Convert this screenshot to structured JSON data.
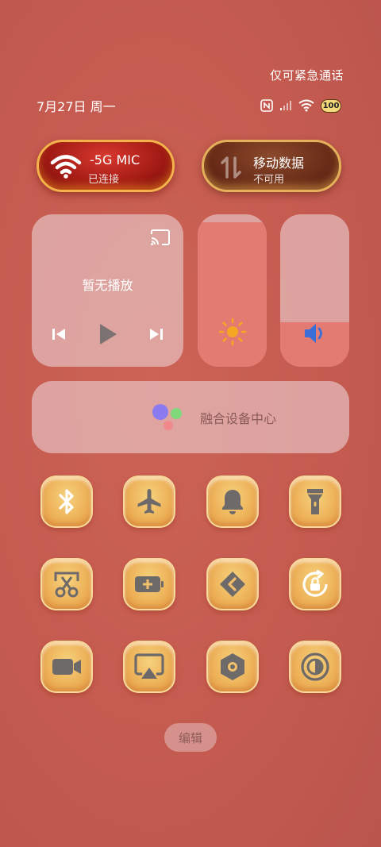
{
  "header": {
    "emergency_text": "仅可紧急通话",
    "date": "7月27日 周一",
    "battery_level": "100"
  },
  "toggles": {
    "wifi": {
      "title": "-5G    MIC",
      "subtitle": "已连接",
      "icon": "wifi-icon",
      "active": true
    },
    "mobile_data": {
      "title": "移动数据",
      "subtitle": "不可用",
      "icon": "data-transfer-icon",
      "active": false
    }
  },
  "media": {
    "status": "暂无播放",
    "icons": [
      "cast-icon",
      "previous-icon",
      "play-icon",
      "next-icon"
    ]
  },
  "brightness": {
    "level": 0.95,
    "icon": "sun-icon"
  },
  "volume": {
    "level": 0.29,
    "icon": "speaker-icon"
  },
  "fusion_center": {
    "label": "融合设备中心",
    "icon": "fusion-dots-icon"
  },
  "tiles": [
    {
      "name": "bluetooth",
      "icon": "bluetooth-icon"
    },
    {
      "name": "airplane-mode",
      "icon": "airplane-icon"
    },
    {
      "name": "ringer",
      "icon": "bell-icon"
    },
    {
      "name": "flashlight",
      "icon": "flashlight-icon"
    },
    {
      "name": "screenshot",
      "icon": "scissors-icon"
    },
    {
      "name": "power-saving",
      "icon": "battery-plus-icon"
    },
    {
      "name": "share",
      "icon": "share-chevron-icon"
    },
    {
      "name": "rotation-lock",
      "icon": "rotation-lock-icon"
    },
    {
      "name": "screen-record",
      "icon": "video-camera-icon"
    },
    {
      "name": "screen-cast",
      "icon": "airplay-icon"
    },
    {
      "name": "settings",
      "icon": "hexagon-settings-icon"
    },
    {
      "name": "dark-mode",
      "icon": "contrast-icon"
    }
  ],
  "edit_button": "编辑",
  "colors": {
    "background": "#c55b50",
    "tile_gold": "#eeb35a",
    "icon_gray": "#6e6a6a",
    "wifi_pill_red": "#a01a14",
    "brightness_fill": "#e37b72",
    "sun_orange": "#f5a623",
    "speaker_blue": "#3a6fd8"
  }
}
